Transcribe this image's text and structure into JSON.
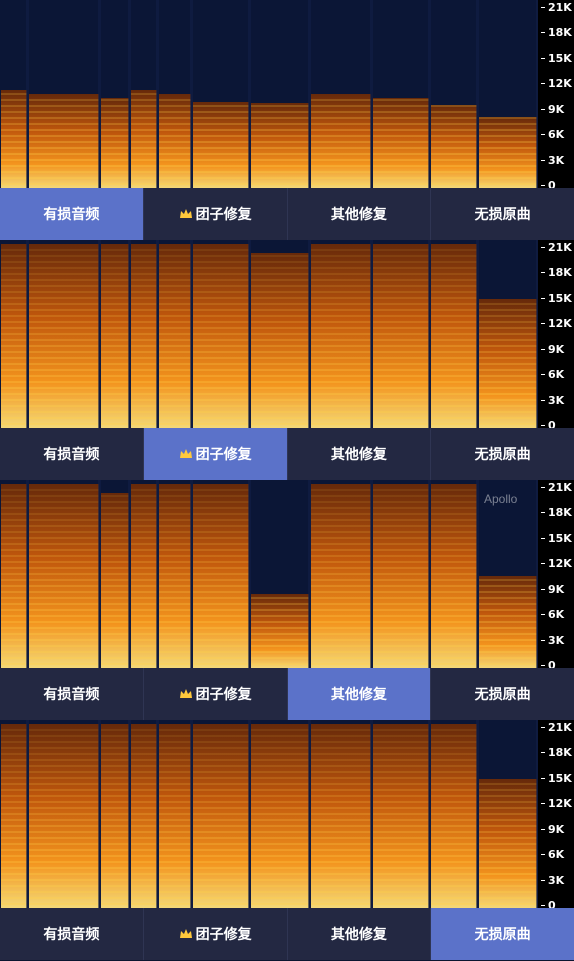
{
  "accent_color": "#5b72c9",
  "tab_bg_color": "#232842",
  "tabs": [
    {
      "label": "有损音频",
      "crown": false
    },
    {
      "label": "团子修复",
      "crown": true
    },
    {
      "label": "其他修复",
      "crown": false
    },
    {
      "label": "无损原曲",
      "crown": false
    }
  ],
  "axis_labels": [
    "21K",
    "18K",
    "15K",
    "12K",
    "9K",
    "6K",
    "3K",
    "0"
  ],
  "panels": [
    {
      "active_tab": 0,
      "watermark": ""
    },
    {
      "active_tab": 1,
      "watermark": ""
    },
    {
      "active_tab": 2,
      "watermark": "Apollo"
    },
    {
      "active_tab": 3,
      "watermark": ""
    }
  ],
  "icons": {
    "crown": "crown-icon"
  }
}
